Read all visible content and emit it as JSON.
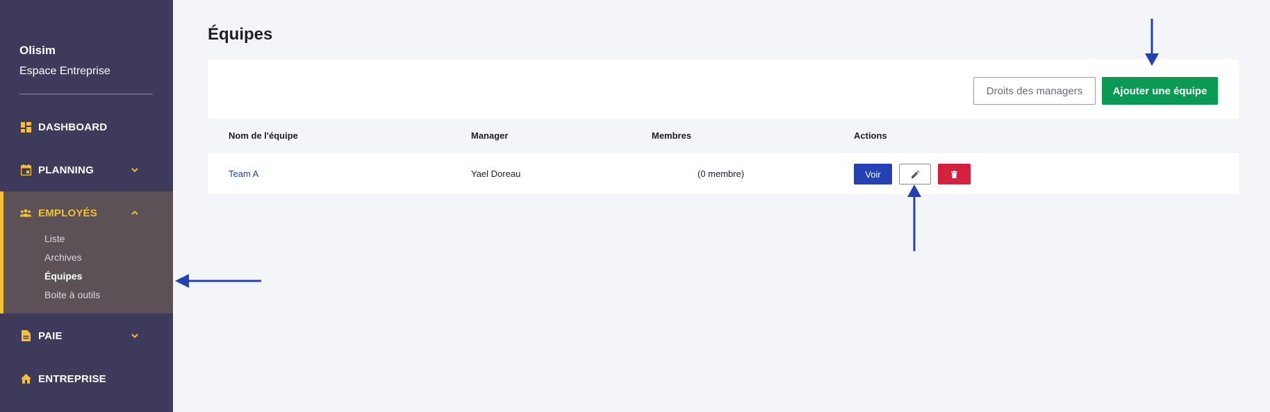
{
  "brand": {
    "name": "Olisim",
    "subtitle": "Espace Entreprise"
  },
  "sidebar": {
    "items": [
      {
        "label": "DASHBOARD",
        "icon": "dashboard-icon"
      },
      {
        "label": "PLANNING",
        "icon": "calendar-icon",
        "expandable": true
      },
      {
        "label": "EMPLOYÉS",
        "icon": "people-icon",
        "expanded": true,
        "active": true,
        "subitems": [
          "Liste",
          "Archives",
          "Équipes",
          "Boite à outils"
        ],
        "active_subitem": "Équipes"
      },
      {
        "label": "PAIE",
        "icon": "document-icon",
        "expandable": true
      },
      {
        "label": "ENTREPRISE",
        "icon": "home-icon"
      }
    ]
  },
  "page": {
    "title": "Équipes"
  },
  "toolbar": {
    "manager_rights_label": "Droits des managers",
    "add_team_label": "Ajouter une équipe"
  },
  "table": {
    "columns": [
      "Nom de l'équipe",
      "Manager",
      "Membres",
      "Actions"
    ],
    "rows": [
      {
        "team": "Team A",
        "manager": "Yael Doreau",
        "members": "(0 membre)",
        "actions": {
          "view_label": "Voir",
          "edit_icon": "pencil-icon",
          "delete_icon": "trash-icon"
        }
      }
    ]
  },
  "colors": {
    "sidebar_bg": "#3d3a5c",
    "sidebar_active_bg": "#5d5158",
    "accent_yellow": "#f5c134",
    "primary_blue": "#2340b5",
    "success_green": "#0a9a53",
    "danger_red": "#d3213f",
    "annotation_arrow": "#2340b5"
  }
}
